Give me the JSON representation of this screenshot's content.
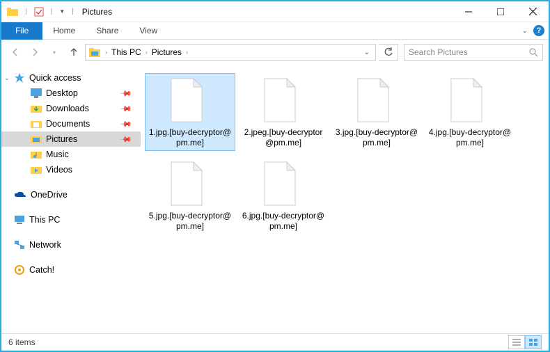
{
  "title": "Pictures",
  "ribbon": {
    "file": "File",
    "tabs": [
      "Home",
      "Share",
      "View"
    ]
  },
  "breadcrumb": {
    "root": "This PC",
    "current": "Pictures"
  },
  "search": {
    "placeholder": "Search Pictures"
  },
  "sidebar": {
    "quick_access": {
      "label": "Quick access",
      "items": [
        {
          "label": "Desktop",
          "pinned": true
        },
        {
          "label": "Downloads",
          "pinned": true
        },
        {
          "label": "Documents",
          "pinned": true
        },
        {
          "label": "Pictures",
          "pinned": true,
          "selected": true
        },
        {
          "label": "Music",
          "pinned": false
        },
        {
          "label": "Videos",
          "pinned": false
        }
      ]
    },
    "onedrive": "OneDrive",
    "this_pc": "This PC",
    "network": "Network",
    "catch": "Catch!"
  },
  "files": [
    {
      "name": "1.jpg.[buy-decryptor@pm.me]",
      "selected": true
    },
    {
      "name": "2.jpeg.[buy-decryptor@pm.me]"
    },
    {
      "name": "3.jpg.[buy-decryptor@pm.me]"
    },
    {
      "name": "4.jpg.[buy-decryptor@pm.me]"
    },
    {
      "name": "5.jpg.[buy-decryptor@pm.me]"
    },
    {
      "name": "6.jpg.[buy-decryptor@pm.me]"
    }
  ],
  "status": {
    "count": "6 items"
  }
}
